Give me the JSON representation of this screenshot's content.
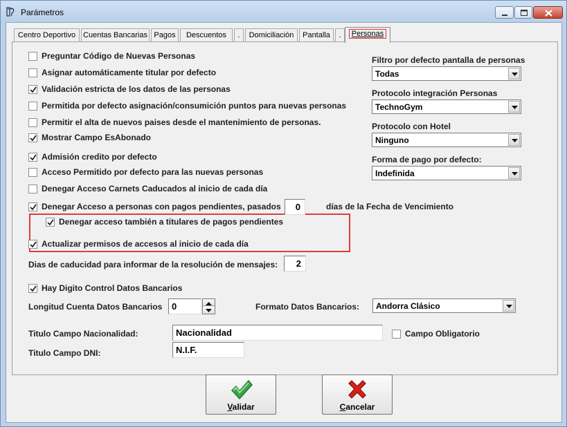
{
  "window": {
    "title": "Parámetros"
  },
  "tabs": [
    {
      "label": "Centro Deportivo"
    },
    {
      "label": "Cuentas Bancarias"
    },
    {
      "label": "Pagos"
    },
    {
      "label": "Descuentos"
    },
    {
      "label": "."
    },
    {
      "label": "Domiciliación"
    },
    {
      "label": "Pantalla"
    },
    {
      "label": "."
    },
    {
      "label": "Personas"
    }
  ],
  "checkboxes": [
    {
      "label": "Preguntar Código de Nuevas Personas",
      "checked": false
    },
    {
      "label": "Asignar automáticamente titular por defecto",
      "checked": false
    },
    {
      "label": "Validación estricta de los datos de las personas",
      "checked": true
    },
    {
      "label": "Permitida por defecto asignación/consumición puntos para nuevas personas",
      "checked": false
    },
    {
      "label": "Permitir el alta de nuevos paises desde el mantenimiento de personas.",
      "checked": false
    },
    {
      "label": "Mostrar Campo EsAbonado",
      "checked": true
    },
    {
      "label": "Admisión credito por defecto",
      "checked": true
    },
    {
      "label": "Acceso Permitido por defecto para las nuevas personas",
      "checked": false
    },
    {
      "label": "Denegar Acceso Carnets Caducados al inicio de cada día",
      "checked": false
    },
    {
      "label": "Denegar Acceso a personas con pagos pendientes, pasados",
      "checked": true
    },
    {
      "label": "Denegar acceso también a titulares de pagos pendientes",
      "checked": true
    },
    {
      "label": "Actualizar permisos de accesos al inicio de cada día",
      "checked": true
    },
    {
      "label": "Hay Digito Control Datos Bancarios",
      "checked": true
    },
    {
      "label": "Campo Obligatorio",
      "checked": false
    }
  ],
  "pending": {
    "days_value": "0",
    "suffix": "días de la Fecha de Vencimiento"
  },
  "expiry": {
    "label": "Dias de caducidad para informar de la resolución de mensajes:",
    "value": "2"
  },
  "right_panel": [
    {
      "label": "Filtro por defecto pantalla de personas",
      "value": "Todas"
    },
    {
      "label": "Protocolo integración Personas",
      "value": "TechnoGym"
    },
    {
      "label": "Protocolo con Hotel",
      "value": "Ninguno"
    },
    {
      "label": "Forma de pago por defecto:",
      "value": "Indefinida"
    }
  ],
  "bank": {
    "length_label": "Longitud Cuenta Datos Bancarios",
    "length_value": "0",
    "format_label": "Formato Datos Bancarios:",
    "format_value": "Andorra Clásico"
  },
  "nationality": {
    "label": "Titulo Campo Nacionalidad:",
    "value": "Nacionalidad"
  },
  "dni": {
    "label": "Titulo Campo DNI:",
    "value": "N.I.F."
  },
  "buttons": {
    "validate": {
      "label_first": "V",
      "label_rest": "alidar"
    },
    "cancel": {
      "label_first": "C",
      "label_rest": "ancelar"
    }
  },
  "colors": {
    "highlight": "#e03c3c",
    "accept": "#3aa64a",
    "cancel": "#d8201a"
  }
}
